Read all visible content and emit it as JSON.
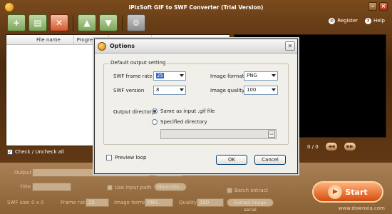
{
  "app": {
    "title": "iPixSoft GIF to SWF Converter (Trial Version)",
    "links": {
      "register": "Register",
      "help": "Help"
    }
  },
  "file_list": {
    "columns": [
      "File name",
      "Progress",
      "Size",
      "Duration"
    ],
    "check_all_label": "Check / Uncheck all"
  },
  "preview": {
    "frame_counter": "0 / 0"
  },
  "output_settings": {
    "output_label": "Output",
    "title_label": "Title",
    "use_input_path_label": "Use input path",
    "more_info_label": "More info...",
    "batch_extract_label": "Batch extract",
    "swf_size_label": "SWF size",
    "swf_size_value": "0 x 0",
    "frame_rate_label": "Frame rate",
    "frame_rate_value": "25",
    "image_format_label": "Image format",
    "image_format_value": "PNG",
    "quality_label": "Quality",
    "quality_value": "100",
    "extract_serial_label": "Extract image serial"
  },
  "start_button": {
    "label": "Start"
  },
  "dialog": {
    "title": "Options",
    "group_label": "Default output setting",
    "swf_frame_rate_label": "SWF frame rate",
    "swf_frame_rate_value": "25",
    "image_format_label": "Image format",
    "image_format_value": "PNG",
    "swf_version_label": "SWF version",
    "swf_version_value": "8",
    "image_quality_label": "Image quality",
    "image_quality_value": "100",
    "output_directory_label": "Output directory",
    "radio_same": "Same as input .gif file",
    "radio_specified": "Specified directory",
    "preview_loop_label": "Preview loop",
    "ok_label": "OK",
    "cancel_label": "Cancel"
  },
  "watermark": "www.downxia.com"
}
